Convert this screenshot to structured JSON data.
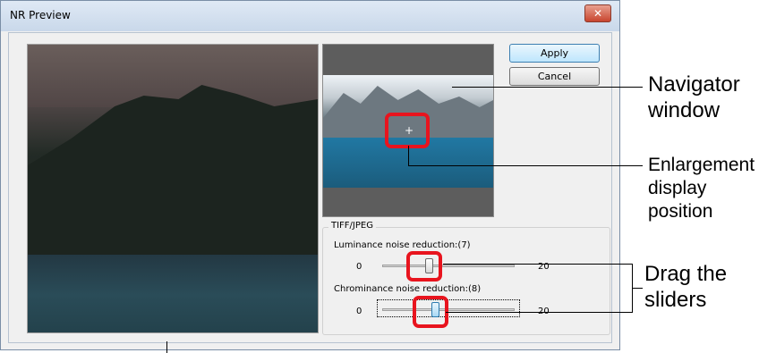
{
  "window": {
    "title": "NR Preview",
    "close_label": "✕"
  },
  "buttons": {
    "apply": "Apply",
    "cancel": "Cancel"
  },
  "group": {
    "label": "TIFF/JPEG",
    "luminance": {
      "label": "Luminance noise reduction:(7)",
      "min": "0",
      "max": "20",
      "value": 7
    },
    "chrominance": {
      "label": "Chrominance noise reduction:(8)",
      "min": "0",
      "max": "20",
      "value": 8
    }
  },
  "navigator": {
    "crosshair": "+"
  },
  "annotations": {
    "navigator_window": [
      "Navigator",
      "window"
    ],
    "enlargement_position": [
      "Enlargement",
      "display",
      "position"
    ],
    "drag_sliders": [
      "Drag the",
      "sliders"
    ]
  },
  "colors": {
    "highlight": "#e8141e",
    "default_button": "#3c7fb1"
  }
}
